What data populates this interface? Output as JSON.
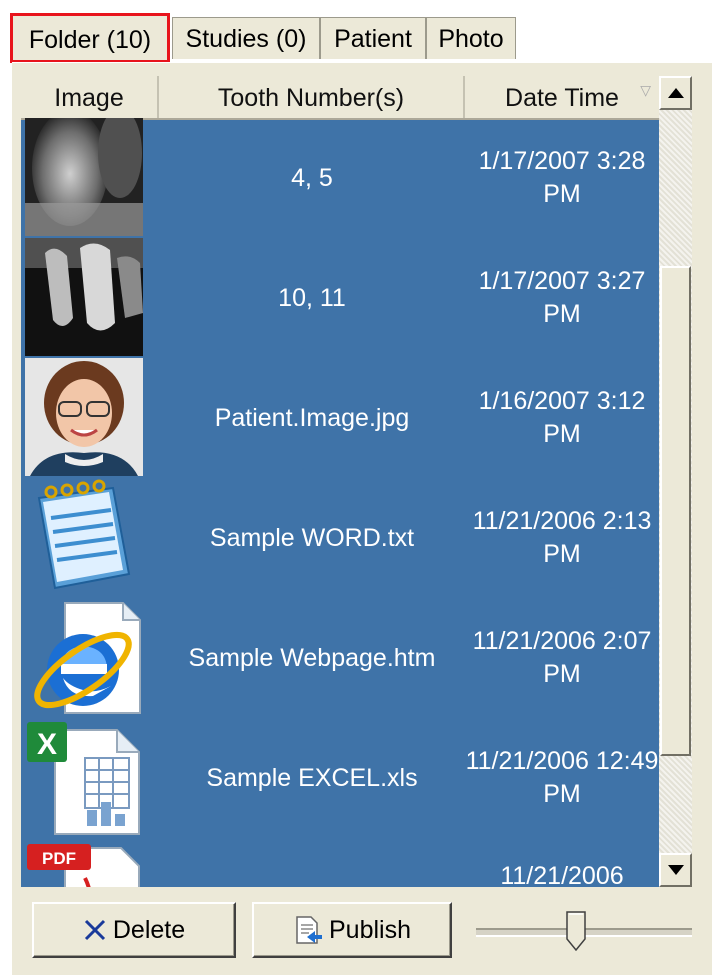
{
  "tabs": [
    {
      "label": "Folder (10)",
      "active": true
    },
    {
      "label": "Studies (0)",
      "active": false
    },
    {
      "label": "Patient",
      "active": false
    },
    {
      "label": "Photo",
      "active": false
    }
  ],
  "columns": [
    "Image",
    "Tooth Number(s)",
    "Date Time"
  ],
  "sort_icon": "sort-desc-icon",
  "rows": [
    {
      "thumb": "xray-image-1",
      "name": "4, 5",
      "date": "1/17/2007 3:28 PM"
    },
    {
      "thumb": "xray-image-2",
      "name": "10, 11",
      "date": "1/17/2007 3:27 PM"
    },
    {
      "thumb": "patient-photo",
      "name": "Patient.Image.jpg",
      "date": "1/16/2007 3:12 PM"
    },
    {
      "thumb": "notepad-icon",
      "name": "Sample WORD.txt",
      "date": "11/21/2006 2:13 PM"
    },
    {
      "thumb": "internet-explorer-icon",
      "name": "Sample Webpage.htm",
      "date": "11/21/2006 2:07 PM"
    },
    {
      "thumb": "excel-icon",
      "name": "Sample EXCEL.xls",
      "date": "11/21/2006 12:49 PM"
    },
    {
      "thumb": "pdf-icon",
      "name": "",
      "date": "11/21/2006"
    }
  ],
  "buttons": {
    "delete": "Delete",
    "publish": "Publish"
  },
  "colors": {
    "grid_bg": "#3f73a8",
    "panel_bg": "#ece9d8",
    "active_tab_border": "#e8141c"
  }
}
